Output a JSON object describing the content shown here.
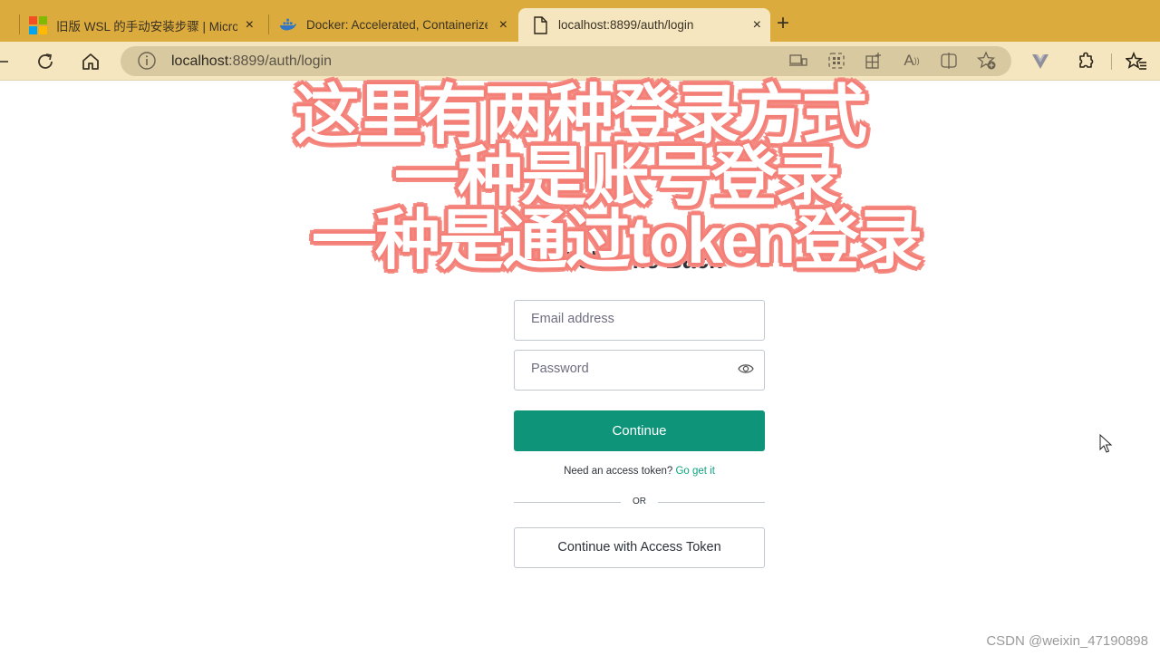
{
  "browser": {
    "tabs": [
      {
        "title": "旧版 WSL 的手动安装步骤 | Micro",
        "icon": "microsoft-logo-icon",
        "active": false
      },
      {
        "title": "Docker: Accelerated, Containerized",
        "icon": "docker-logo-icon",
        "active": false
      },
      {
        "title": "localhost:8899/auth/login",
        "icon": "page-icon",
        "active": true
      }
    ],
    "close_symbol": "×",
    "new_tab_symbol": "+",
    "address": {
      "host": "localhost",
      "rest": ":8899/auth/login"
    },
    "toolbar_icons": [
      "back-icon",
      "refresh-icon",
      "home-icon",
      "info-icon",
      "device-icon",
      "apps-icon",
      "add-app-icon",
      "read-aloud-icon",
      "split-screen-icon",
      "favorite-add-icon",
      "vue-devtools-icon",
      "extensions-icon",
      "favorites-icon"
    ]
  },
  "overlay": {
    "line1": "这里有两种登录方式",
    "line2": "一种是账号登录",
    "line3": "一种是通过token登录",
    "color": "#f37f77"
  },
  "login": {
    "heading": "Welcome Back",
    "email_placeholder": "Email address",
    "password_placeholder": "Password",
    "continue_label": "Continue",
    "need_token_text": "Need an access token?",
    "go_get_it_link": "Go get it",
    "or_text": "OR",
    "access_token_button": "Continue with Access Token",
    "accent_color": "#10a37f"
  },
  "watermark": "CSDN @weixin_47190898"
}
